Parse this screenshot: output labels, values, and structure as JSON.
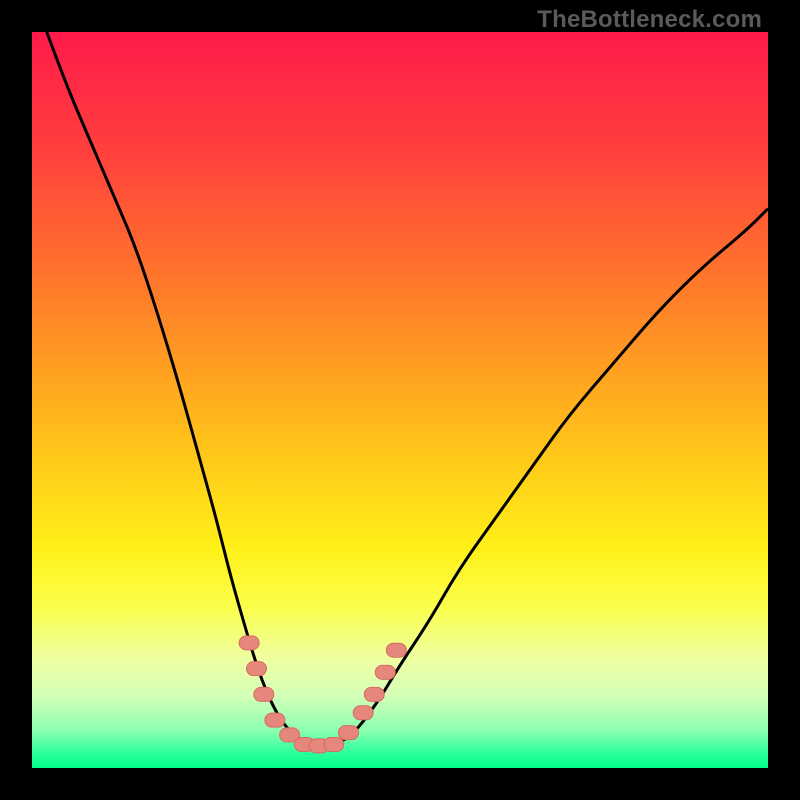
{
  "watermark": "TheBottleneck.com",
  "colors": {
    "frame": "#000000",
    "curve": "#000000",
    "marker_fill": "#e6877c",
    "marker_stroke": "#d66b62"
  },
  "chart_data": {
    "type": "line",
    "title": "",
    "xlabel": "",
    "ylabel": "",
    "xlim": [
      0,
      100
    ],
    "ylim": [
      0,
      100
    ],
    "gradient_stops": [
      {
        "pos": 0,
        "color": "#ff1a4b"
      },
      {
        "pos": 16,
        "color": "#ff3f3d"
      },
      {
        "pos": 35,
        "color": "#ff7b2a"
      },
      {
        "pos": 55,
        "color": "#ffbf1a"
      },
      {
        "pos": 70,
        "color": "#fff017"
      },
      {
        "pos": 78,
        "color": "#fbff4a"
      },
      {
        "pos": 85,
        "color": "#efffa0"
      },
      {
        "pos": 90,
        "color": "#d6ffb8"
      },
      {
        "pos": 95,
        "color": "#8affb0"
      },
      {
        "pos": 98,
        "color": "#2aff9c"
      },
      {
        "pos": 100,
        "color": "#00ff8a"
      }
    ],
    "series": [
      {
        "name": "bottleneck-curve",
        "x": [
          2,
          5,
          8,
          11,
          14,
          17,
          20,
          22.5,
          25,
          27,
          29,
          30.5,
          32,
          33.5,
          35,
          37,
          38.5,
          40,
          42,
          44,
          47,
          50,
          54,
          58,
          63,
          68,
          73,
          79,
          85,
          91,
          97,
          100
        ],
        "y": [
          100,
          92,
          85,
          78,
          71,
          62,
          52,
          43,
          34,
          26,
          19,
          14,
          10,
          7,
          5,
          3.5,
          3,
          3,
          3.5,
          5,
          9,
          14,
          20,
          27,
          34,
          41,
          48,
          55,
          62,
          68,
          73,
          76
        ]
      }
    ],
    "markers": {
      "name": "valley-highlight",
      "points": [
        {
          "x": 29.5,
          "y": 17
        },
        {
          "x": 30.5,
          "y": 13.5
        },
        {
          "x": 31.5,
          "y": 10
        },
        {
          "x": 33,
          "y": 6.5
        },
        {
          "x": 35,
          "y": 4.5
        },
        {
          "x": 37,
          "y": 3.2
        },
        {
          "x": 39,
          "y": 3.0
        },
        {
          "x": 41,
          "y": 3.2
        },
        {
          "x": 43,
          "y": 4.8
        },
        {
          "x": 45,
          "y": 7.5
        },
        {
          "x": 46.5,
          "y": 10
        },
        {
          "x": 48,
          "y": 13
        },
        {
          "x": 49.5,
          "y": 16
        }
      ]
    }
  }
}
